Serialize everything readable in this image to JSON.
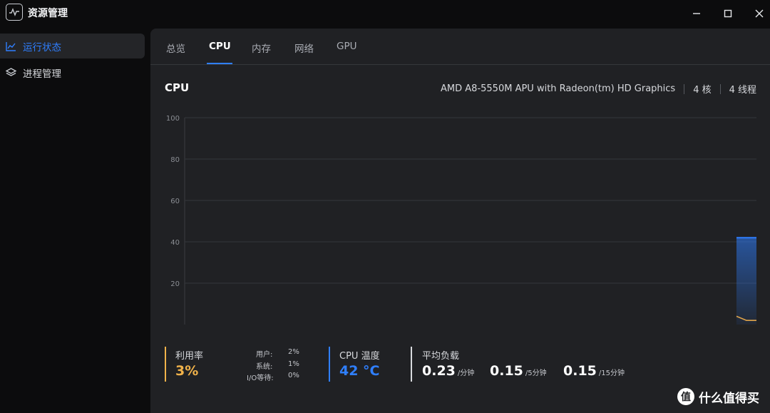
{
  "app": {
    "title": "资源管理"
  },
  "sidebar": {
    "items": [
      {
        "label": "运行状态",
        "icon": "line-chart-icon",
        "active": true
      },
      {
        "label": "进程管理",
        "icon": "layers-icon",
        "active": false
      }
    ]
  },
  "tabs": [
    "总览",
    "CPU",
    "内存",
    "网络",
    "GPU"
  ],
  "active_tab": "CPU",
  "cpu": {
    "heading": "CPU",
    "model": "AMD A8-5550M APU with Radeon(tm) HD Graphics",
    "cores": "4 核",
    "threads": "4 线程"
  },
  "chart_data": {
    "type": "area",
    "y_ticks": [
      "100",
      "80",
      "60",
      "40",
      "20"
    ],
    "ylim": [
      0,
      100
    ],
    "grid": true,
    "series": [
      {
        "color": "#2f7fff",
        "values": [
          42,
          42,
          42
        ]
      },
      {
        "color": "#e0a44a",
        "values": [
          4,
          2,
          2
        ]
      }
    ]
  },
  "stats": {
    "usage": {
      "label": "利用率",
      "value": "3%",
      "color": "#f0b24a",
      "breakdown": [
        {
          "label": "用户:",
          "value": "2%"
        },
        {
          "label": "系统:",
          "value": "1%"
        },
        {
          "label": "I/O等待:",
          "value": "0%"
        }
      ]
    },
    "temp": {
      "label": "CPU 温度",
      "value": "42 °C",
      "color": "#2f7fff"
    },
    "load": {
      "label": "平均负载",
      "color": "#d7d9dd",
      "values": [
        {
          "value": "0.23",
          "unit": "/分钟"
        },
        {
          "value": "0.15",
          "unit": "/5分钟"
        },
        {
          "value": "0.15",
          "unit": "/15分钟"
        }
      ]
    }
  },
  "watermark": {
    "symbol": "值",
    "text": "什么值得买"
  }
}
